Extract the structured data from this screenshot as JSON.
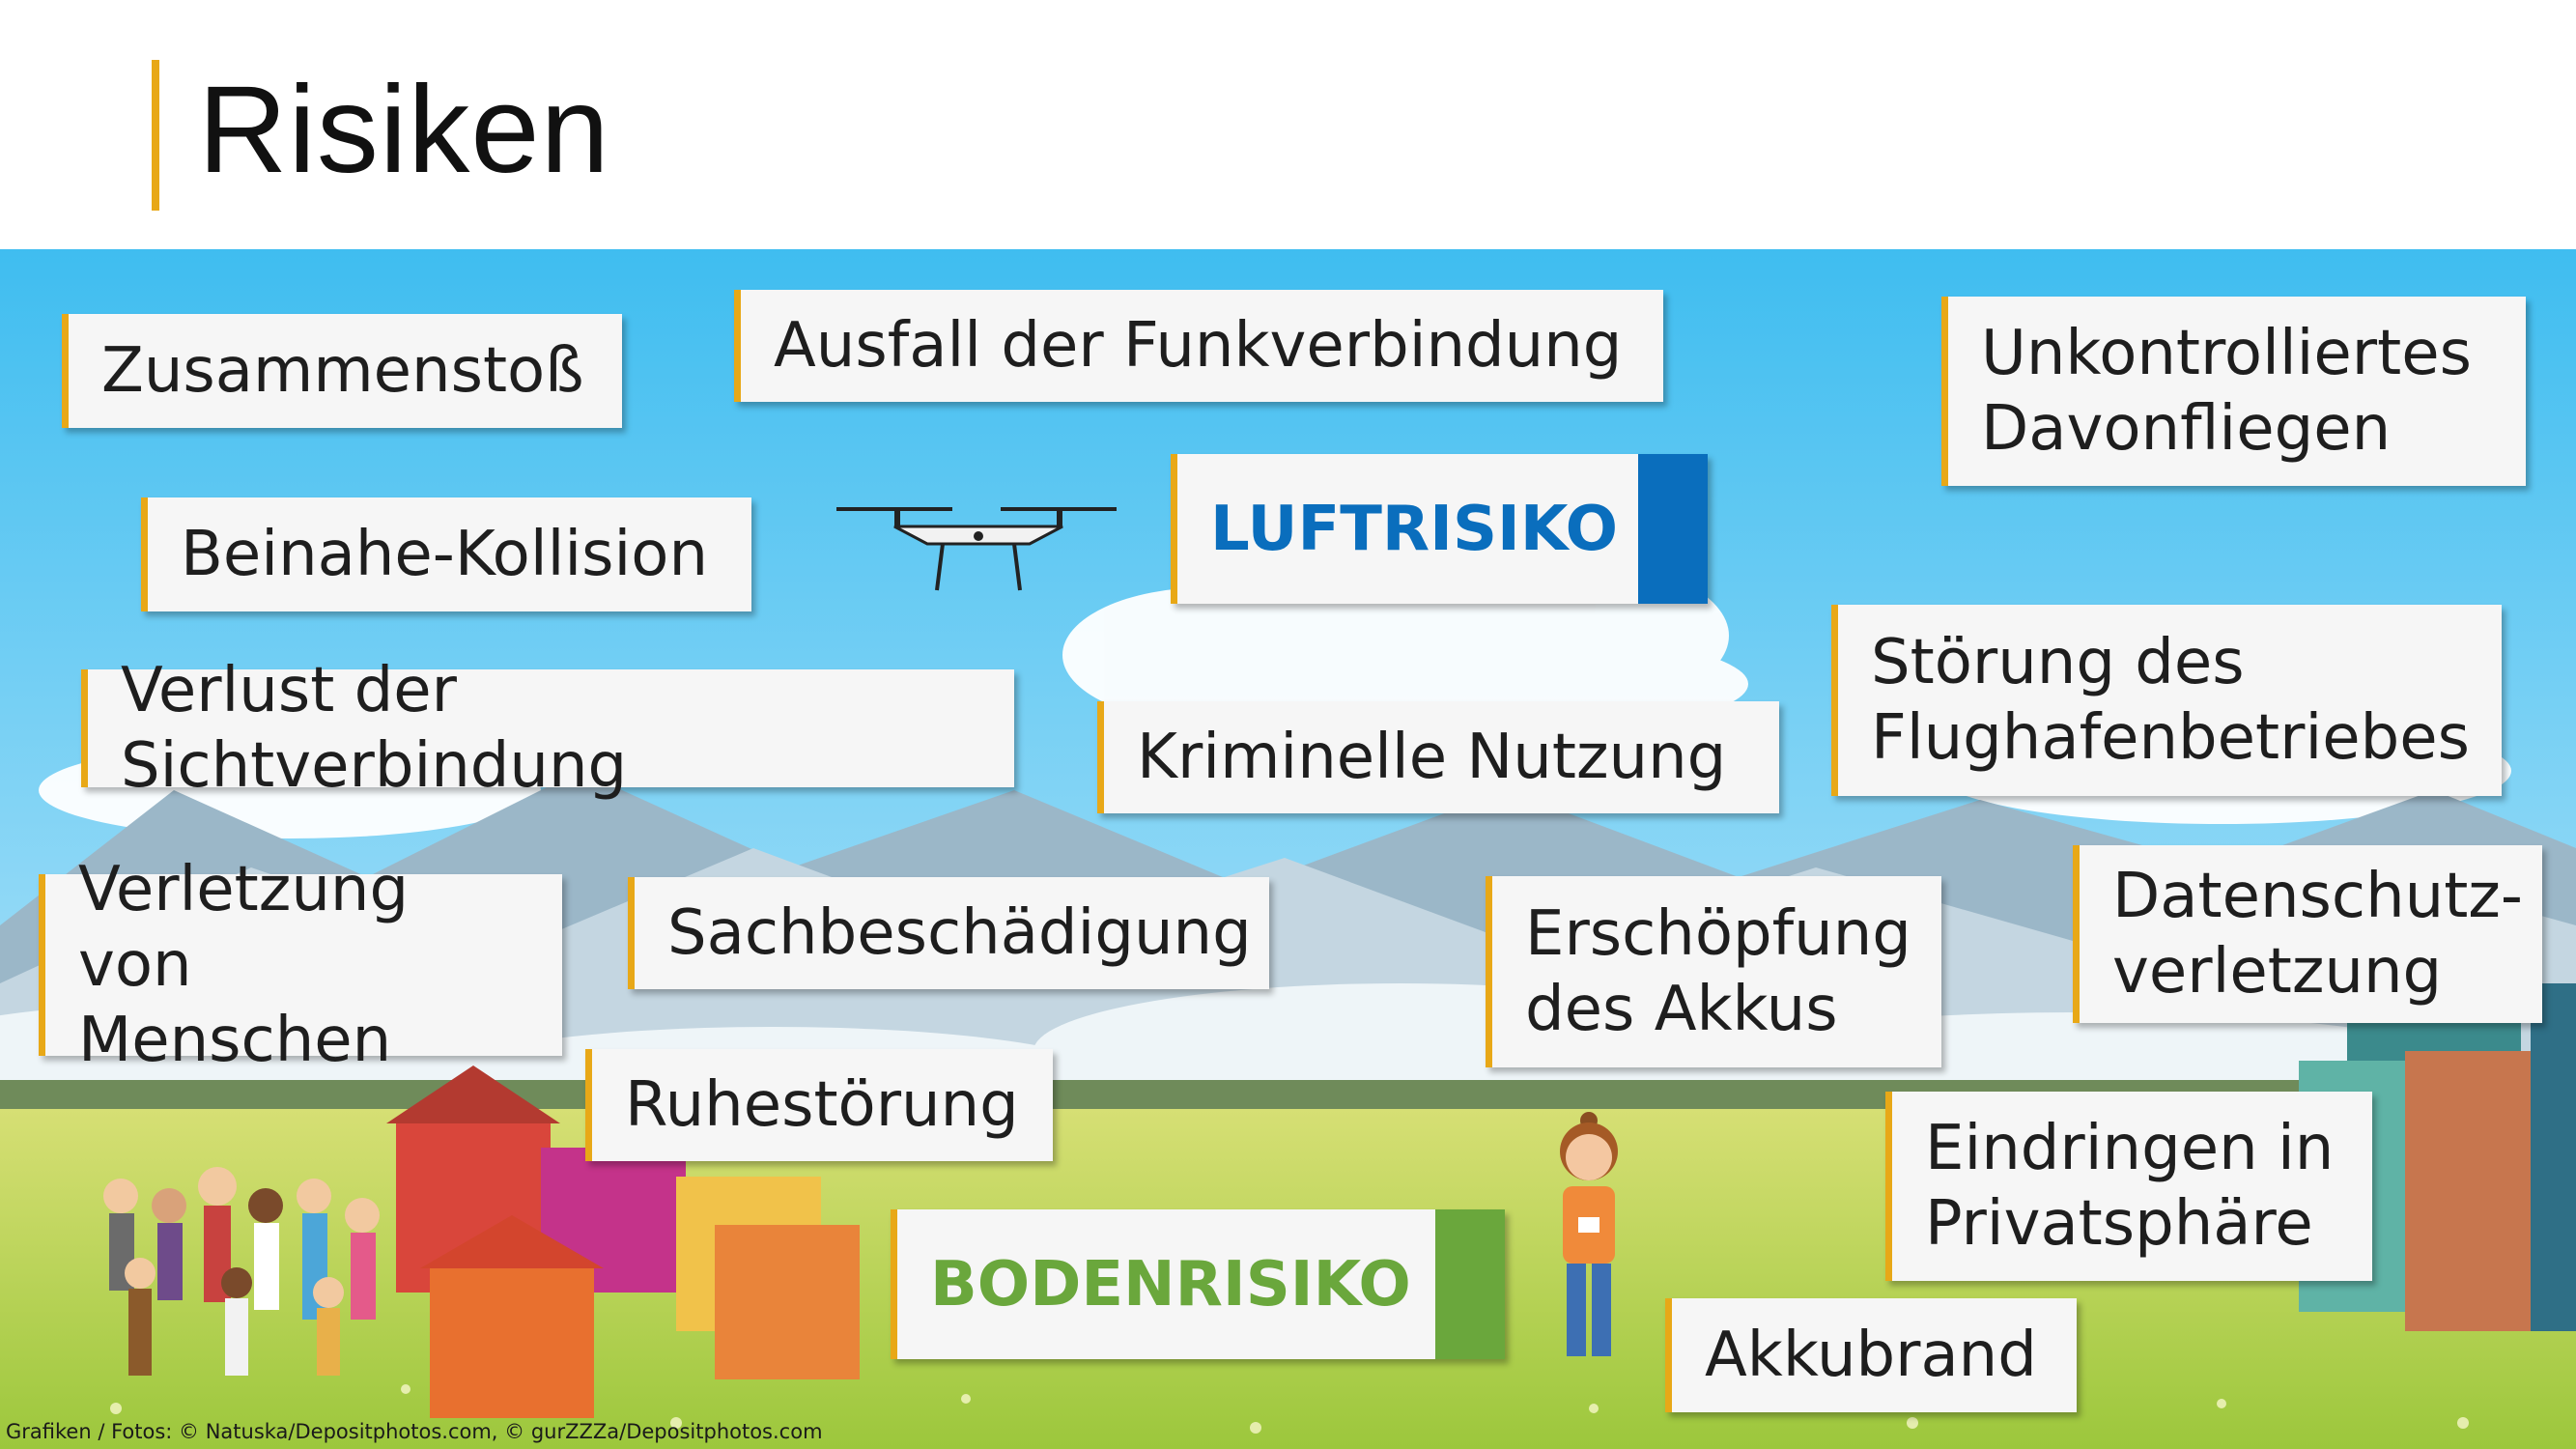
{
  "title": "Risiken",
  "colors": {
    "accent": "#e8a817",
    "air": "#0a6ebd",
    "ground": "#6aa73c",
    "sky": "#4fc3ef",
    "meadow": "#b8d24a"
  },
  "categories": {
    "air": "LUFTRISIKO",
    "ground": "BODENRISIKO"
  },
  "risks": {
    "zusammenstoss": "Zusammenstoß",
    "funk": "Ausfall der Funkverbindung",
    "davonfliegen": "Unkontrolliertes\nDavonfliegen",
    "beinahe": "Beinahe-Kollision",
    "sicht": "Verlust der Sichtverbindung",
    "kriminell": "Kriminelle Nutzung",
    "flughafen": "Störung des\nFlughafenbetriebes",
    "verletzung": "Verletzung von\nMenschen",
    "sach": "Sachbeschädigung",
    "akku": "Erschöpfung\ndes Akkus",
    "datenschutz": "Datenschutz-\nverletzung",
    "ruhe": "Ruhestörung",
    "privat": "Eindringen in\nPrivatsphäre",
    "akkubrand": "Akkubrand"
  },
  "credit": "Grafiken / Fotos: © Natuska/Depositphotos.com, © gurZZZa/Depositphotos.com",
  "icons": {
    "drone": "drone-icon",
    "people": "people-group-icon",
    "houses": "houses-icon",
    "pilot": "drone-pilot-icon",
    "buildings": "office-buildings-icon"
  }
}
